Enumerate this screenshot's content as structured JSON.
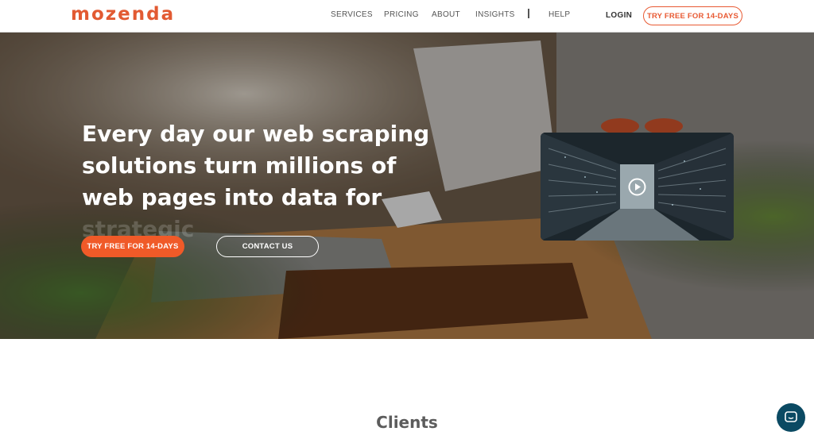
{
  "header": {
    "logo": "mozenda",
    "nav": [
      {
        "label": "SERVICES",
        "name": "nav-services"
      },
      {
        "label": "PRICING",
        "name": "nav-pricing"
      },
      {
        "label": "ABOUT",
        "name": "nav-about"
      },
      {
        "label": "INSIGHTS",
        "name": "nav-insights"
      },
      {
        "label": "HELP",
        "name": "nav-help"
      }
    ],
    "login": "LOGIN",
    "trial_button": "TRY FREE FOR 14-DAYS"
  },
  "hero": {
    "headline": "Every day our web scraping solutions turn millions of web pages into data for",
    "headline_faded": "strategic",
    "primary_button": "TRY FREE FOR 14-DAYS",
    "secondary_button": "CONTACT US",
    "video_icon": "play-icon"
  },
  "clients_heading": "Clients",
  "chat_icon": "chat-icon",
  "colors": {
    "brand": "#e25a32",
    "primary_button": "#f05a28",
    "chat": "#0b4a63"
  }
}
